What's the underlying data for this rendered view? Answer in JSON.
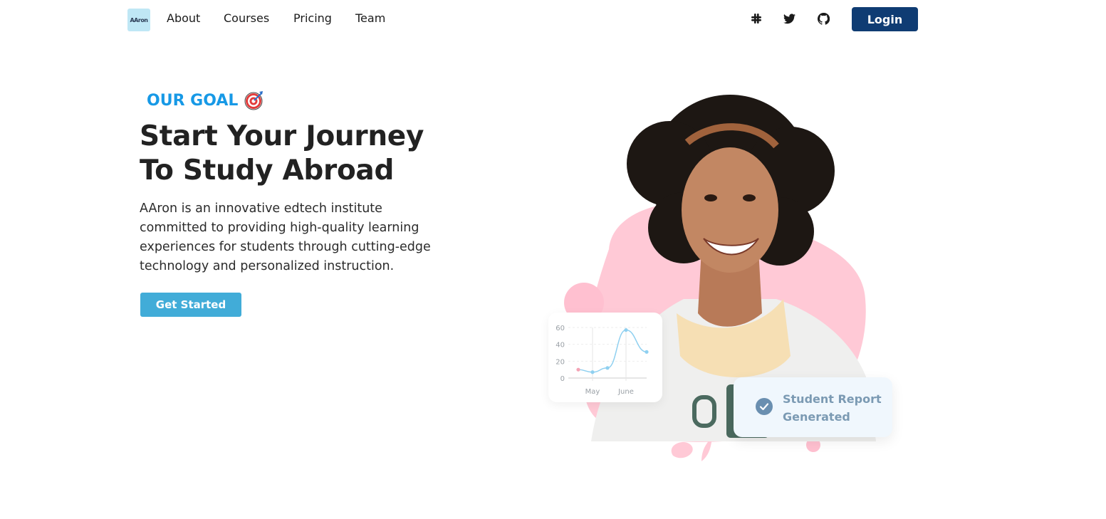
{
  "nav": {
    "logo_text": "AAron",
    "links": [
      "About",
      "Courses",
      "Pricing",
      "Team"
    ],
    "social_icons": [
      "slack-icon",
      "twitter-icon",
      "github-icon"
    ],
    "login_label": "Login"
  },
  "hero": {
    "eyebrow": "OUR GOAL",
    "eyebrow_icon": "target-icon",
    "headline_line1": "Start Your Journey",
    "headline_line2": "To Study Abroad",
    "description": "AAron is an innovative edtech institute committed to providing high-quality learning experiences for students through cutting-edge technology and personalized instruction.",
    "cta_label": "Get Started"
  },
  "chart_card": {
    "chart_data": {
      "type": "line",
      "x": [
        "",
        "May",
        "",
        "June",
        ""
      ],
      "values": [
        10,
        7,
        12,
        57,
        31
      ],
      "ylim": [
        0,
        60
      ],
      "yticks": [
        "60",
        "40",
        "20",
        "0"
      ],
      "xticks": [
        "May",
        "June"
      ]
    }
  },
  "report_card": {
    "line1": "Student Report",
    "line2": "Generated"
  },
  "colors": {
    "accent": "#1799e6",
    "login_bg": "#0f3c73",
    "cta_bg": "#41acd8",
    "blob": "#ffc9d6"
  }
}
